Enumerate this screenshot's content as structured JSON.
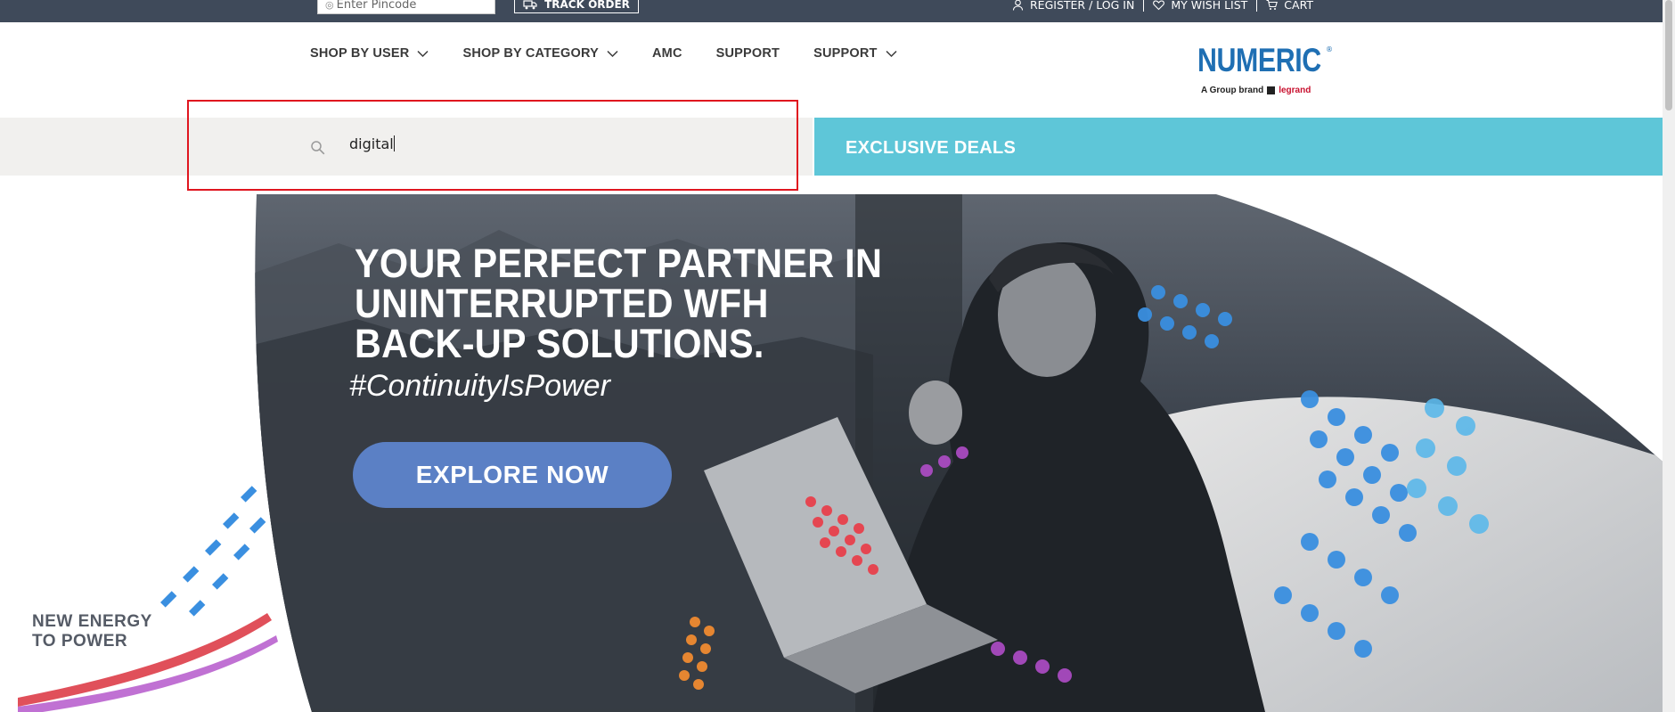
{
  "topbar": {
    "pincode_placeholder": "Enter Pincode",
    "track_order": "TRACK ORDER",
    "register_login": "REGISTER / LOG IN",
    "wishlist": "MY WISH LIST",
    "cart": "CART"
  },
  "nav": {
    "items": [
      {
        "label": "SHOP BY USER",
        "dropdown": true
      },
      {
        "label": "SHOP BY CATEGORY",
        "dropdown": true
      },
      {
        "label": "AMC",
        "dropdown": false
      },
      {
        "label": "SUPPORT",
        "dropdown": false
      },
      {
        "label": "SUPPORT",
        "dropdown": true
      }
    ]
  },
  "logo": {
    "brand": "NUMERIC",
    "registered": "®",
    "sub_prefix": "A Group brand",
    "sub_brand": "legrand"
  },
  "search": {
    "value": "digital"
  },
  "deals": {
    "label": "EXCLUSIVE DEALS"
  },
  "hero": {
    "headline": [
      "YOUR PERFECT PARTNER IN",
      "UNINTERRUPTED WFH",
      "BACK-UP SOLUTIONS."
    ],
    "hashtag": "#ContinuityIsPower",
    "cta": "EXPLORE NOW",
    "tagline": [
      "NEW ENERGY",
      "TO POWER"
    ]
  },
  "colors": {
    "topbar": "#3f4a5a",
    "deals": "#5ec6d8",
    "cta": "#5b80c5",
    "brand_blue": "#1f6fb3",
    "highlight": "#e0161f"
  }
}
